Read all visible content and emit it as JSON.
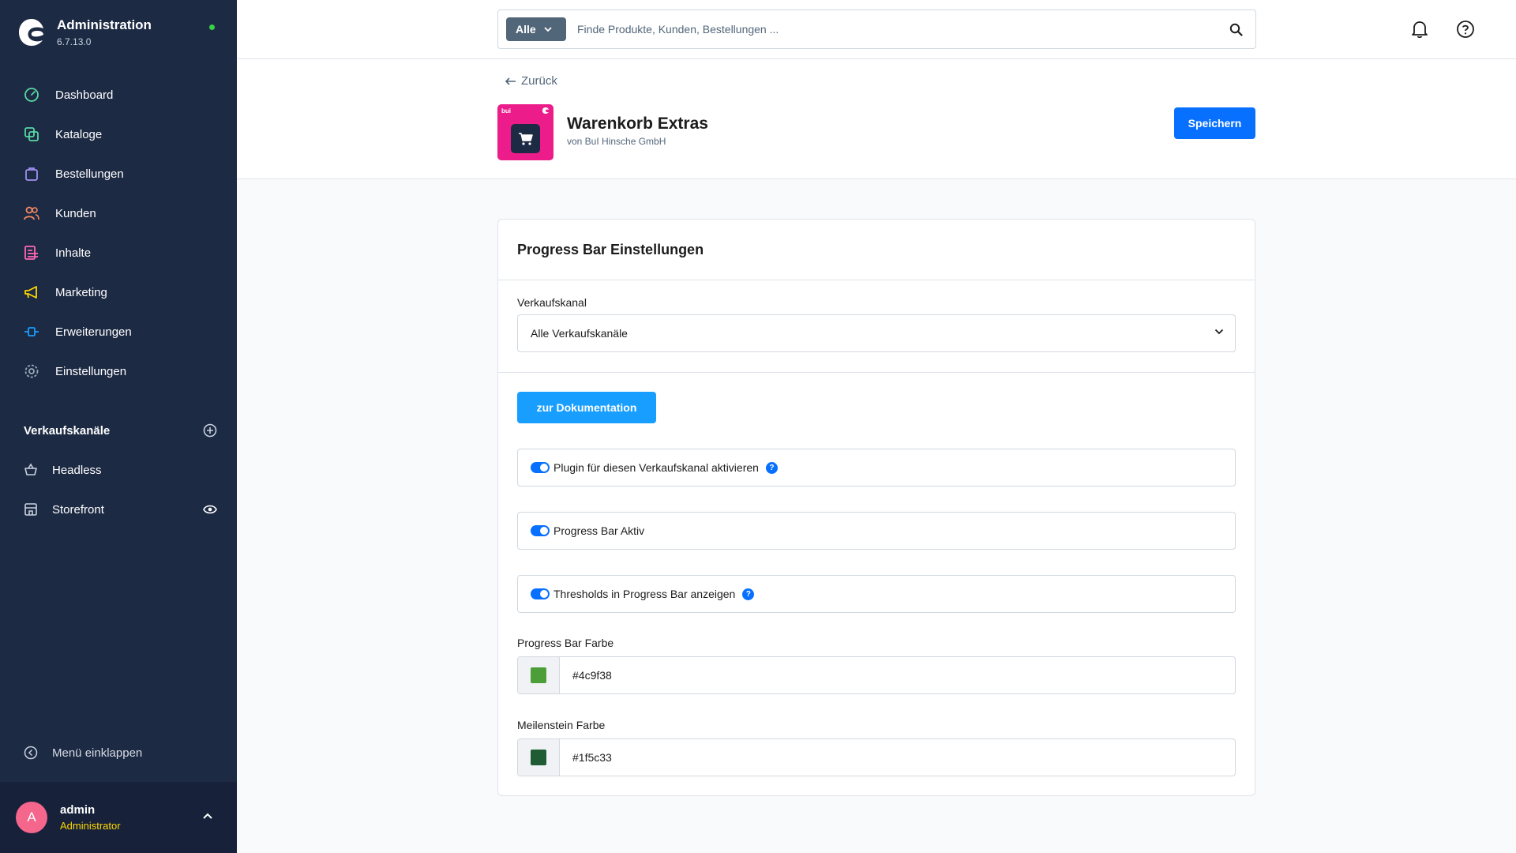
{
  "sidebar": {
    "brand_title": "Administration",
    "brand_version": "6.7.13.0",
    "nav": [
      {
        "label": "Dashboard",
        "icon": "dashboard-icon",
        "color": "#57d9a3"
      },
      {
        "label": "Kataloge",
        "icon": "catalog-icon",
        "color": "#57d9a3"
      },
      {
        "label": "Bestellungen",
        "icon": "bag-icon",
        "color": "#a092f0"
      },
      {
        "label": "Kunden",
        "icon": "users-icon",
        "color": "#f88962"
      },
      {
        "label": "Inhalte",
        "icon": "content-icon",
        "color": "#ff68b4"
      },
      {
        "label": "Marketing",
        "icon": "megaphone-icon",
        "color": "#ffd700"
      },
      {
        "label": "Erweiterungen",
        "icon": "plug-icon",
        "color": "#189eff"
      },
      {
        "label": "Einstellungen",
        "icon": "gear-icon",
        "color": "#9aa8b5"
      }
    ],
    "sales_channels_title": "Verkaufskanäle",
    "sales_channels": [
      {
        "label": "Headless"
      },
      {
        "label": "Storefront"
      }
    ],
    "collapse_label": "Menü einklappen",
    "user": {
      "initial": "A",
      "name": "admin",
      "role": "Administrator"
    }
  },
  "topbar": {
    "search_type": "Alle",
    "search_placeholder": "Finde Produkte, Kunden, Bestellungen ..."
  },
  "smartbar": {
    "back_label": "Zurück",
    "app_title": "Warenkorb Extras",
    "app_vendor": "von BuI Hinsche GmbH",
    "app_icon_text": "bui",
    "save_label": "Speichern"
  },
  "card": {
    "title": "Progress Bar Einstellungen",
    "sales_channel_label": "Verkaufskanal",
    "sales_channel_value": "Alle Verkaufskanäle",
    "doc_button": "zur Dokumentation",
    "switches": [
      {
        "label": "Plugin für diesen Verkaufskanal aktivieren",
        "enabled": true,
        "help": true
      },
      {
        "label": "Progress Bar Aktiv",
        "enabled": true,
        "help": false
      },
      {
        "label": "Thresholds in Progress Bar anzeigen",
        "enabled": true,
        "help": true
      }
    ],
    "help_glyph": "?",
    "progress_color_label": "Progress Bar Farbe",
    "progress_color_value": "#4c9f38",
    "milestone_color_label": "Meilenstein Farbe",
    "milestone_color_value": "#1f5c33"
  }
}
